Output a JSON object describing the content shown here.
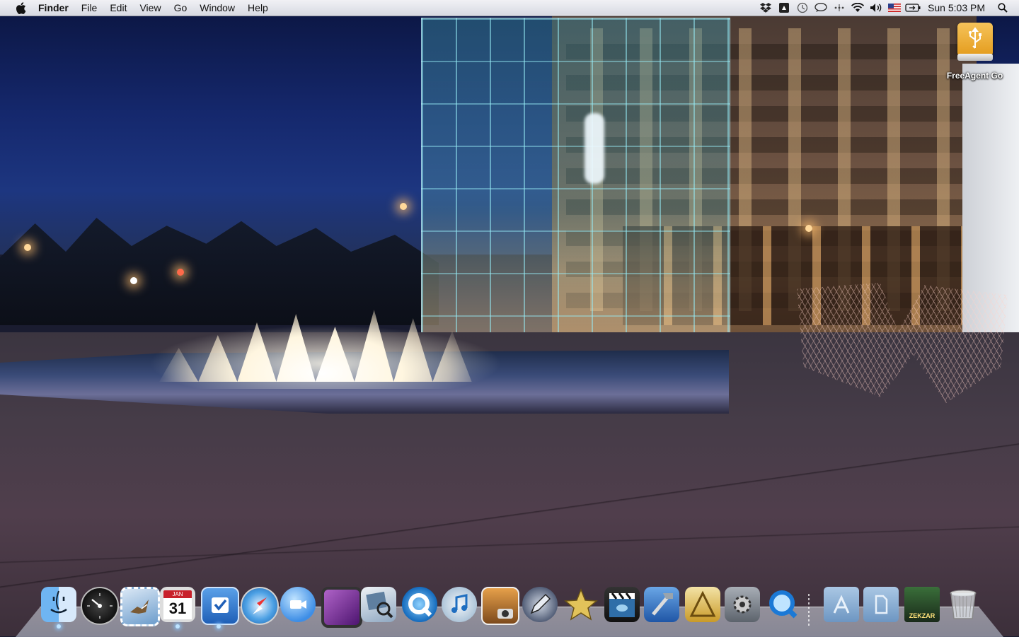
{
  "menubar": {
    "app_name": "Finder",
    "items": [
      "File",
      "Edit",
      "View",
      "Go",
      "Window",
      "Help"
    ],
    "clock": "Sun 5:03 PM",
    "status_icons": [
      "dropbox-icon",
      "box-icon",
      "time-machine-icon",
      "chat-icon",
      "bluetooth-icon",
      "wifi-icon",
      "volume-icon",
      "us-flag-icon",
      "battery-icon",
      "spotlight-icon"
    ]
  },
  "desktop": {
    "icons": [
      {
        "label": "FreeAgent Go",
        "icon": "usb-drive-icon"
      }
    ]
  },
  "dock": {
    "apps": [
      {
        "name": "finder",
        "running": true
      },
      {
        "name": "dashboard",
        "running": false
      },
      {
        "name": "mail",
        "running": false
      },
      {
        "name": "ical",
        "running": true,
        "month": "JAN",
        "day": "31"
      },
      {
        "name": "things",
        "running": true
      },
      {
        "name": "safari",
        "running": false
      },
      {
        "name": "ichat",
        "running": false
      },
      {
        "name": "front-row",
        "running": false
      },
      {
        "name": "preview",
        "running": false
      },
      {
        "name": "quicktime-x",
        "running": false
      },
      {
        "name": "itunes",
        "running": false
      },
      {
        "name": "iphoto",
        "running": false
      },
      {
        "name": "pixelmator",
        "running": false
      },
      {
        "name": "imovie",
        "running": false
      },
      {
        "name": "final-cut",
        "running": false
      },
      {
        "name": "xcode",
        "running": false
      },
      {
        "name": "instruments",
        "running": false
      },
      {
        "name": "system-preferences",
        "running": false
      },
      {
        "name": "quicktime",
        "running": false
      }
    ],
    "stacks": [
      {
        "name": "applications-folder"
      },
      {
        "name": "documents-folder"
      },
      {
        "name": "game"
      },
      {
        "name": "trash"
      }
    ],
    "game_title": "ZEKZAR"
  }
}
